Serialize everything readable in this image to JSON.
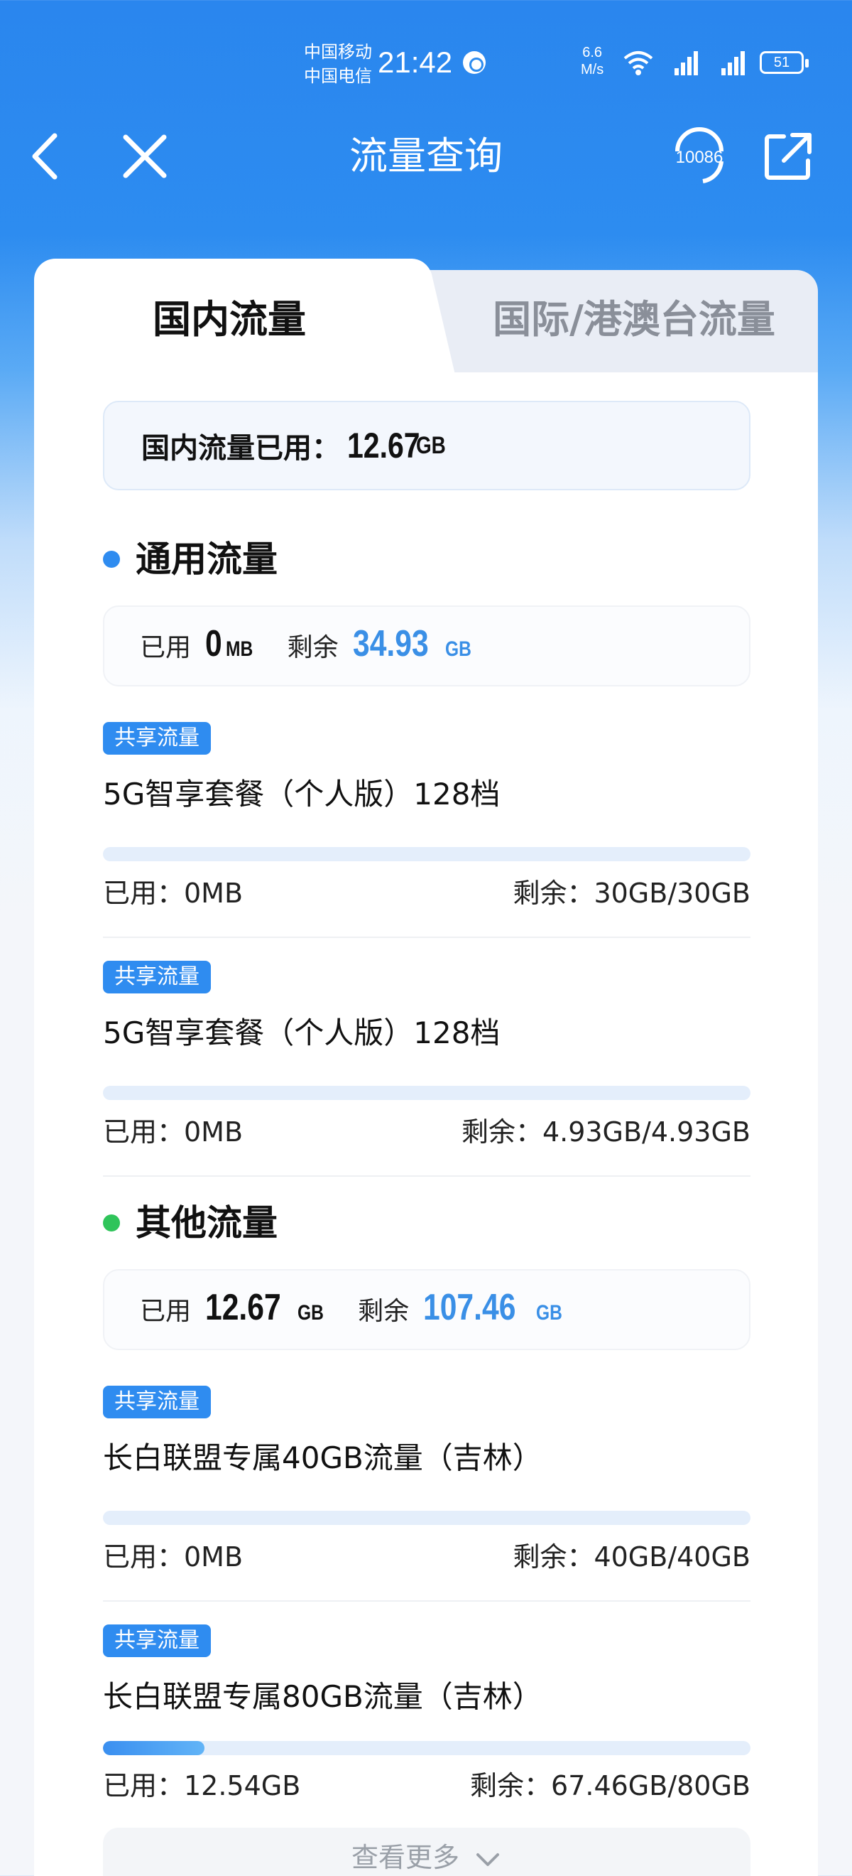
{
  "status_bar": {
    "carrier_1": "中国移动",
    "carrier_2": "中国电信",
    "time": "21:42",
    "net_speed_value": "6.6",
    "net_speed_unit": "M/s",
    "battery": "51",
    "icons": [
      "wifi-6-icon",
      "signal-5g-icon",
      "signal-4g-icon",
      "battery-icon"
    ]
  },
  "nav": {
    "title": "流量查询",
    "hotline_label": "10086",
    "icons": {
      "back": "chevron-left-icon",
      "close": "close-icon",
      "hotline": "headset-icon",
      "share": "share-icon"
    }
  },
  "tabs": [
    {
      "label": "国内流量",
      "active": true
    },
    {
      "label": "国际/港澳台流量",
      "active": false
    }
  ],
  "domestic_total": {
    "label": "国内流量已用：",
    "value": "12.67",
    "unit": "GB"
  },
  "sections": [
    {
      "title": "通用流量",
      "dot_color": "#2f8cf0",
      "used_label": "已用",
      "used_value": "0",
      "used_unit": "MB",
      "remain_label": "剩余",
      "remain_value": "34.93",
      "remain_unit": "GB",
      "items": [
        {
          "badge": "共享流量",
          "name": "5G智享套餐（个人版）128档",
          "used": "已用：0MB",
          "remain": "剩余：30GB/30GB",
          "progress": 0
        },
        {
          "badge": "共享流量",
          "name": "5G智享套餐（个人版）128档",
          "used": "已用：0MB",
          "remain": "剩余：4.93GB/4.93GB",
          "progress": 0
        }
      ]
    },
    {
      "title": "其他流量",
      "dot_color": "#2fc45a",
      "used_label": "已用",
      "used_value": "12.67",
      "used_unit": "GB",
      "remain_label": "剩余",
      "remain_value": "107.46",
      "remain_unit": "GB",
      "items": [
        {
          "badge": "共享流量",
          "name": "长白联盟专属40GB流量（吉林）",
          "used": "已用：0MB",
          "remain": "剩余：40GB/40GB",
          "progress": 0
        },
        {
          "badge": "共享流量",
          "name": "长白联盟专属80GB流量（吉林）",
          "used": "已用：12.54GB",
          "remain": "剩余：67.46GB/80GB",
          "progress": 0.157
        }
      ]
    }
  ],
  "more_button": {
    "label": "查看更多"
  },
  "colors": {
    "accent": "#2f8cf0",
    "remain_text": "#3a8fe6",
    "track": "#e4eefb"
  }
}
